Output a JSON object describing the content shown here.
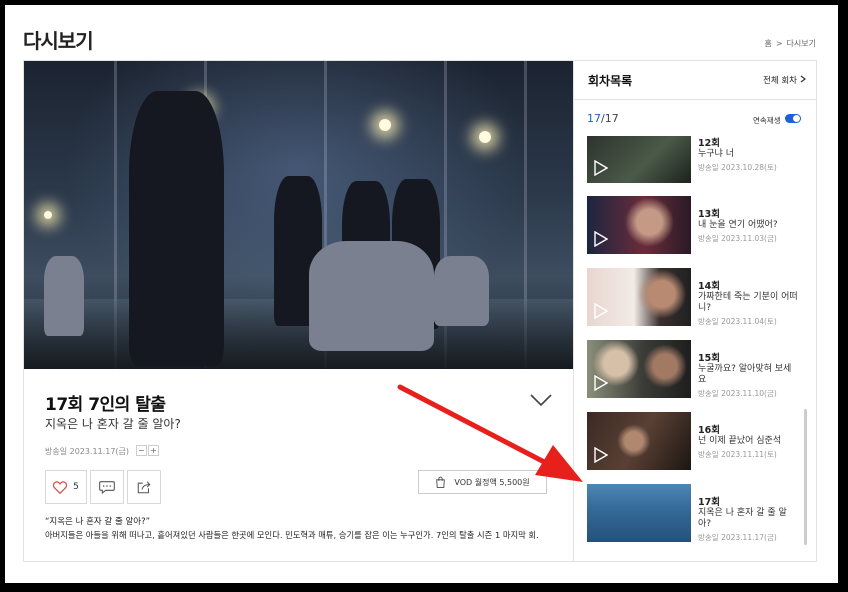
{
  "page": {
    "title": "다시보기"
  },
  "breadcrumb": {
    "home": "홈",
    "sep": ">",
    "current": "다시보기"
  },
  "episode": {
    "heading": "17회 7인의 탈출",
    "subtitle": "지옥은 나 혼자 갈 줄 알아?",
    "air_date": "방송일 2023.11.17(금)",
    "font_minus": "−",
    "font_plus": "+",
    "like_count": "5",
    "vod_label": "VOD 월정액 5,500원",
    "quote": "“지옥은 나 혼자 갈 줄 알아?”",
    "description": "아버지들은 아들을 위해 떠나고, 흩어져있던 사람들은 한곳에 모인다. 민도혁과 매튜, 승기를 잡은 이는 누구인가. 7인의 탈출 시즌 1 마지막 회."
  },
  "sidebar": {
    "title": "회차목록",
    "all_link": "전체 회차",
    "counter_current": "17",
    "counter_total": "/17",
    "autoplay_label": "연속재생",
    "autoplay_on": true,
    "items": [
      {
        "ep": "12회",
        "title": "누구냐 너",
        "date": "방송일 2023.10.28(토)"
      },
      {
        "ep": "13회",
        "title": "내 눈을 연기 어땠어?",
        "date": "방송일 2023.11.03(금)"
      },
      {
        "ep": "14회",
        "title": "가짜한테 죽는 기분이 어떠니?",
        "date": "방송일 2023.11.04(토)"
      },
      {
        "ep": "15회",
        "title": "누굴까요? 알아맞혀 보세요",
        "date": "방송일 2023.11.10(금)"
      },
      {
        "ep": "16회",
        "title": "넌 이제 끝났어 심준석",
        "date": "방송일 2023.11.11(토)"
      },
      {
        "ep": "17회",
        "title": "지옥은 나 혼자 갈 줄 알아?",
        "date": "방송일 2023.11.17(금)"
      }
    ]
  },
  "colors": {
    "accent": "#1a63d2",
    "arrow": "#e8201c"
  },
  "icons": [
    "heart-icon",
    "comment-icon",
    "share-icon",
    "shopping-bag-icon",
    "chevron-down-icon",
    "play-icon",
    "chevron-right-icon"
  ]
}
